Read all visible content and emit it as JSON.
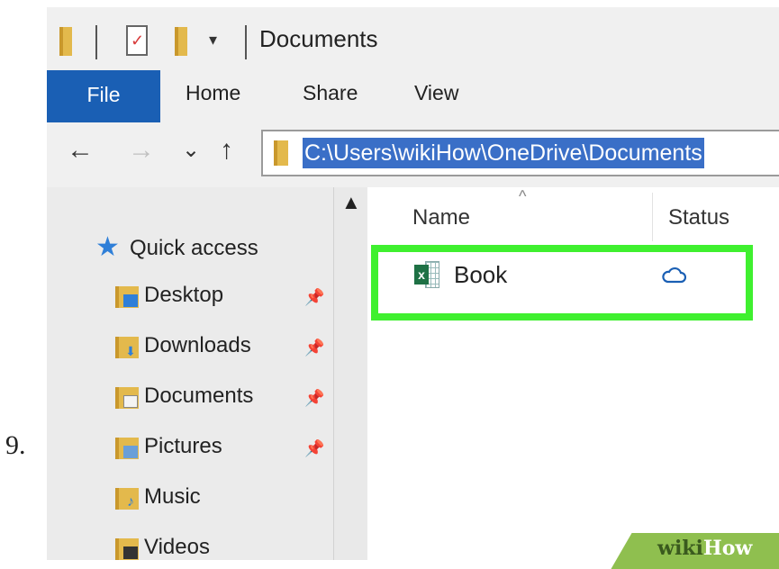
{
  "step_number": "9.",
  "window": {
    "title": "Documents",
    "quick_access_toolbar": [
      "folder-icon",
      "properties-icon",
      "new-folder-icon",
      "customize-dropdown-icon"
    ],
    "qa_dropdown_glyph": "▾"
  },
  "ribbon": {
    "tabs": [
      {
        "label": "File",
        "active": true
      },
      {
        "label": "Home"
      },
      {
        "label": "Share"
      },
      {
        "label": "View"
      }
    ]
  },
  "navigation": {
    "back_glyph": "←",
    "forward_glyph": "→",
    "recent_glyph": "⌄",
    "up_glyph": "↑",
    "address_path": "C:\\Users\\wikiHow\\OneDrive\\Documents"
  },
  "nav_pane": {
    "quick_access": "Quick access",
    "items": [
      {
        "label": "Desktop",
        "icon": "desktop-folder-icon",
        "pinned": true
      },
      {
        "label": "Downloads",
        "icon": "downloads-folder-icon",
        "pinned": true
      },
      {
        "label": "Documents",
        "icon": "documents-folder-icon",
        "pinned": true
      },
      {
        "label": "Pictures",
        "icon": "pictures-folder-icon",
        "pinned": true
      },
      {
        "label": "Music",
        "icon": "music-folder-icon",
        "pinned": false
      },
      {
        "label": "Videos",
        "icon": "videos-folder-icon",
        "pinned": false
      }
    ],
    "pin_glyph": "📌"
  },
  "file_list": {
    "sort_glyph": "^",
    "columns": [
      "Name",
      "Status"
    ],
    "rows": [
      {
        "name": "Book",
        "icon": "excel-file-icon",
        "status": "cloud-icon",
        "highlighted": true
      }
    ]
  },
  "colors": {
    "accent": "#1a5fb4",
    "highlight": "#3ff02f",
    "selection": "#3a6fc7"
  },
  "watermark": {
    "part1": "wiki",
    "part2": "How"
  }
}
